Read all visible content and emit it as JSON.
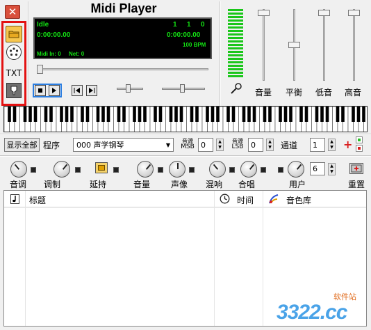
{
  "app": {
    "title": "Midi Player",
    "close_label": "✕"
  },
  "toolbar": {
    "txt_label": "TXT"
  },
  "lcd": {
    "status": "Idle",
    "bar": "1",
    "beat": "1",
    "tick": "0",
    "elapsed_time": "0:00:00.00",
    "total_time": "0:00:00.00",
    "tempo": "100 BPM",
    "midi_in": "Midi In: 0",
    "net": "Net: 0"
  },
  "faders": {
    "volume_label": "音量",
    "balance_label": "平衡",
    "bass_label": "低音",
    "treble_label": "高音"
  },
  "program_row": {
    "show_all_label": "显示全部",
    "program_label": "程序",
    "program_value": "000 声学钢琴",
    "msb_top": "音源",
    "msb_bottom": "MSB",
    "msb_value": "0",
    "lsb_top": "音源",
    "lsb_bottom": "LSB",
    "lsb_value": "0",
    "channel_label": "通道",
    "channel_value": "1",
    "add_symbol": "+",
    "remove_symbol": "✖"
  },
  "knobs": {
    "tune_label": "音调",
    "modulation_label": "调制",
    "sustain_label": "延持",
    "volume_label": "音量",
    "pan_label": "声像",
    "reverb_label": "混响",
    "chorus_label": "合唱",
    "user_label": "用户",
    "user_value": "6",
    "reset_label": "重置"
  },
  "playlist": {
    "columns": [
      "标题",
      "时间",
      "音色库"
    ]
  },
  "watermark": {
    "text": "3322.cc",
    "subtext": "软件站"
  },
  "colors": {
    "lcd_background": "#000000",
    "lcd_text": "#13e213",
    "highlight_box": "#e31212",
    "transport_border": "#2a7de0",
    "meter": "#1ac61a",
    "add_button": "#d92020",
    "remove_button": "#d92020",
    "led_green": "#27c027"
  },
  "icons": {
    "open": "folder-icon",
    "instruments": "palette-icon",
    "lyrics": "txt-icon",
    "edit": "pen-icon",
    "microphone": "microphone-icon",
    "title_column": "music-note-icon",
    "time_column": "clock-icon",
    "soundbank_column": "soundbank-icon"
  }
}
